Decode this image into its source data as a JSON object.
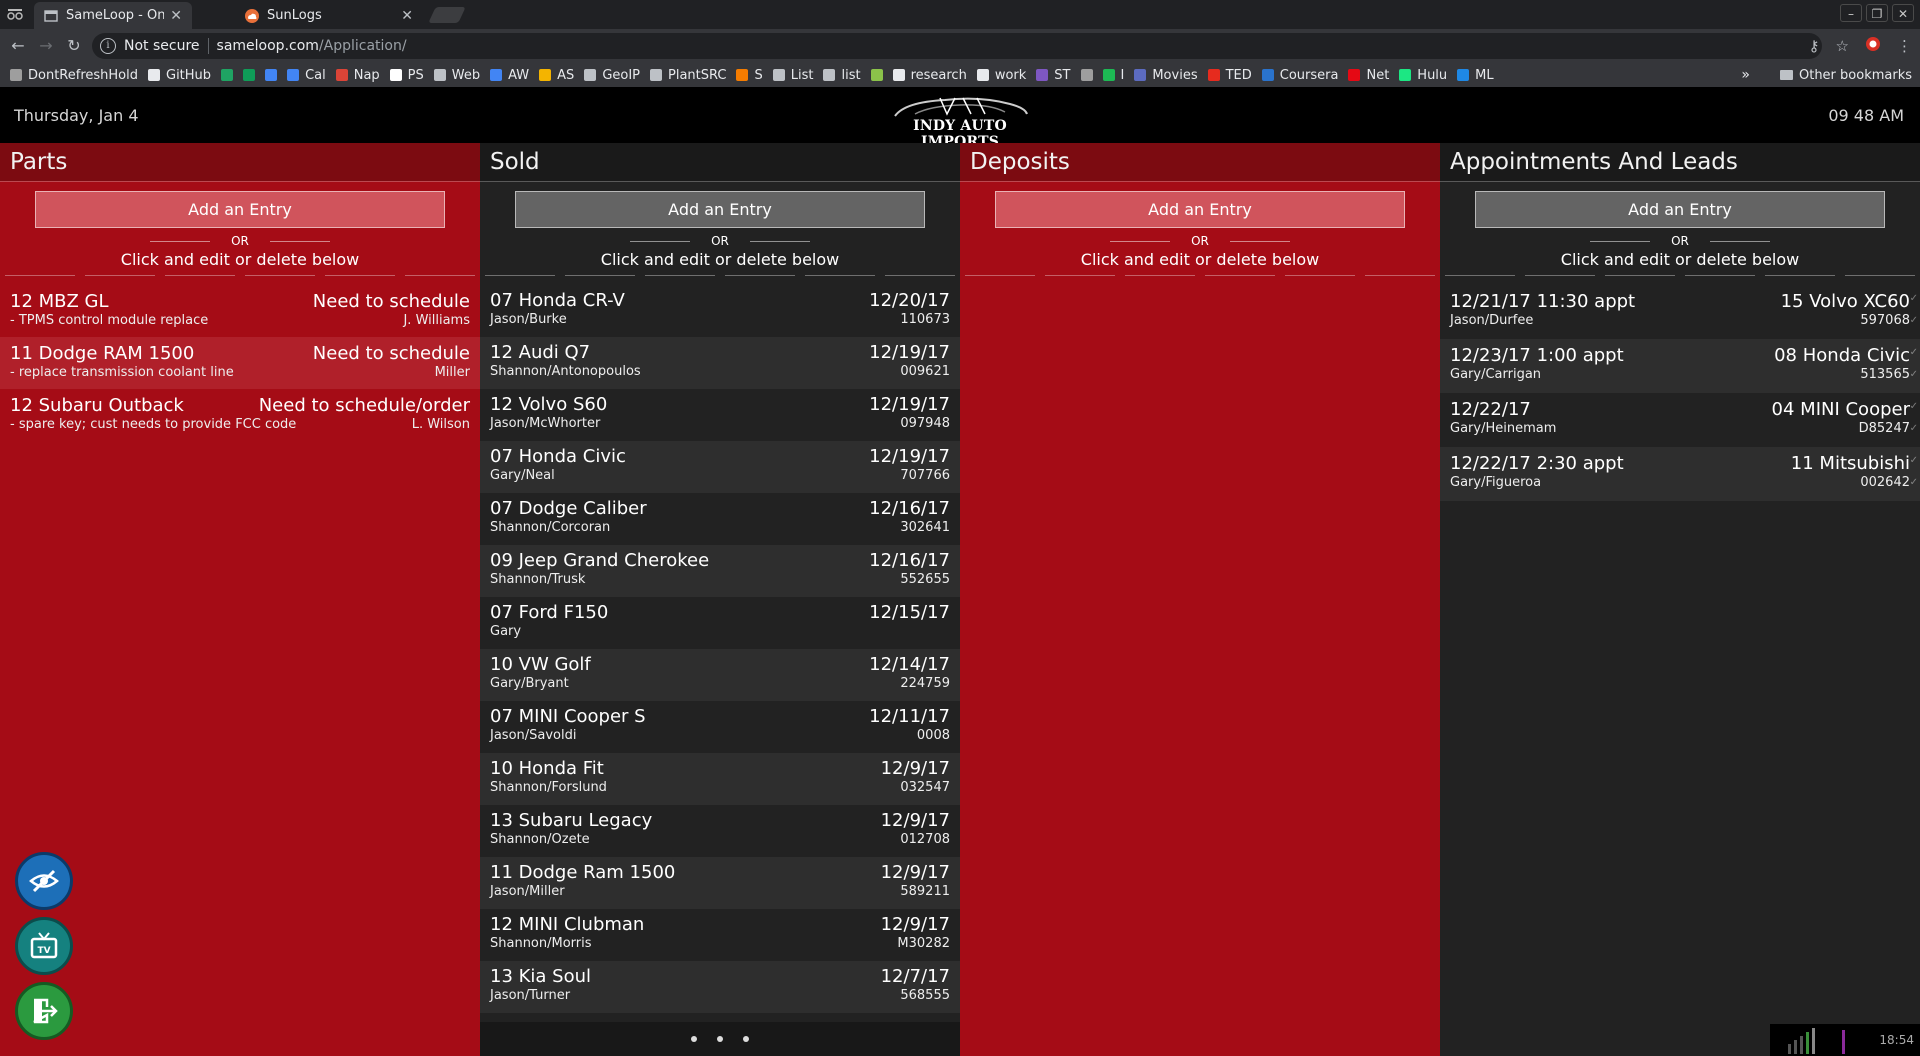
{
  "browser": {
    "tabs": [
      {
        "label": "SameLoop - On the",
        "active": true,
        "icon": "page-icon"
      },
      {
        "label": "SunLogs",
        "active": false,
        "icon": "cloud-icon"
      }
    ],
    "security_label": "Not secure",
    "url_host": "sameloop.com",
    "url_path": "/Application/",
    "bookmarks": [
      {
        "label": "DontRefreshHold",
        "color": "#9e9e9e"
      },
      {
        "label": "GitHub",
        "color": "#e8eaed"
      },
      {
        "label": "",
        "color": "#1fa463"
      },
      {
        "label": "",
        "color": "#0f9d58"
      },
      {
        "label": "",
        "color": "#4285f4"
      },
      {
        "label": "Cal",
        "color": "#4285f4"
      },
      {
        "label": "Nap",
        "color": "#db4437"
      },
      {
        "label": "PS",
        "color": "#ffffff"
      },
      {
        "label": "Web",
        "color": "#bdc1c6"
      },
      {
        "label": "AW",
        "color": "#4285f4"
      },
      {
        "label": "AS",
        "color": "#f4b400"
      },
      {
        "label": "GeoIP",
        "color": "#bdc1c6"
      },
      {
        "label": "PlantSRC",
        "color": "#bdc1c6"
      },
      {
        "label": "S",
        "color": "#f57c00"
      },
      {
        "label": "List",
        "color": "#bdc1c6"
      },
      {
        "label": "list",
        "color": "#bdc1c6"
      },
      {
        "label": "",
        "color": "#8bc34a"
      },
      {
        "label": "research",
        "color": "#e8eaed"
      },
      {
        "label": "work",
        "color": "#e8eaed"
      },
      {
        "label": "ST",
        "color": "#7e57c2"
      },
      {
        "label": "",
        "color": "#9e9e9e"
      },
      {
        "label": "I",
        "color": "#1db954"
      },
      {
        "label": "Movies",
        "color": "#5c6bc0"
      },
      {
        "label": "TED",
        "color": "#e62b1e"
      },
      {
        "label": "Coursera",
        "color": "#2a73cc"
      },
      {
        "label": "Net",
        "color": "#e50914"
      },
      {
        "label": "Hulu",
        "color": "#1ce783"
      },
      {
        "label": "ML",
        "color": "#1e88e5"
      }
    ],
    "bookmarks_overflow": "»",
    "other_bookmarks": "Other bookmarks"
  },
  "header": {
    "date": "Thursday, Jan 4",
    "time": "09 48 AM",
    "logo_text": "INDY AUTO IMPORTS"
  },
  "common": {
    "add_label": "Add an Entry",
    "or_label": "OR",
    "instruction": "Click and edit or delete below"
  },
  "columns": {
    "parts": {
      "title": "Parts",
      "items": [
        {
          "title": "12 MBZ GL",
          "sub": "- TPMS control module replace",
          "right": "Need to schedule",
          "right_sub": "J. Williams"
        },
        {
          "title": "11 Dodge RAM 1500",
          "sub": "- replace transmission coolant line",
          "right": "Need to schedule",
          "right_sub": "Miller"
        },
        {
          "title": "12 Subaru Outback",
          "sub": "- spare key; cust needs to provide FCC code",
          "right": "Need to schedule/order",
          "right_sub": "L. Wilson"
        }
      ]
    },
    "sold": {
      "title": "Sold",
      "items": [
        {
          "title": "07 Honda CR-V",
          "sub": "Jason/Burke",
          "right": "12/20/17",
          "right_sub": "110673"
        },
        {
          "title": "12 Audi Q7",
          "sub": "Shannon/Antonopoulos",
          "right": "12/19/17",
          "right_sub": "009621"
        },
        {
          "title": "12 Volvo S60",
          "sub": "Jason/McWhorter",
          "right": "12/19/17",
          "right_sub": "097948"
        },
        {
          "title": "07 Honda Civic",
          "sub": "Gary/Neal",
          "right": "12/19/17",
          "right_sub": "707766"
        },
        {
          "title": "07 Dodge Caliber",
          "sub": "Shannon/Corcoran",
          "right": "12/16/17",
          "right_sub": "302641"
        },
        {
          "title": "09 Jeep Grand Cherokee",
          "sub": "Shannon/Trusk",
          "right": "12/16/17",
          "right_sub": "552655"
        },
        {
          "title": "07 Ford F150",
          "sub": "Gary",
          "right": "12/15/17",
          "right_sub": ""
        },
        {
          "title": "10 VW Golf",
          "sub": "Gary/Bryant",
          "right": "12/14/17",
          "right_sub": "224759"
        },
        {
          "title": "07 MINI Cooper S",
          "sub": "Jason/Savoldi",
          "right": "12/11/17",
          "right_sub": "0008"
        },
        {
          "title": "10 Honda Fit",
          "sub": "Shannon/Forslund",
          "right": "12/9/17",
          "right_sub": "032547"
        },
        {
          "title": "13 Subaru Legacy",
          "sub": "Shannon/Ozete",
          "right": "12/9/17",
          "right_sub": "012708"
        },
        {
          "title": "11 Dodge Ram 1500",
          "sub": "Jason/Miller",
          "right": "12/9/17",
          "right_sub": "589211"
        },
        {
          "title": "12 MINI Clubman",
          "sub": "Shannon/Morris",
          "right": "12/9/17",
          "right_sub": "M30282"
        },
        {
          "title": "13 Kia Soul",
          "sub": "Jason/Turner",
          "right": "12/7/17",
          "right_sub": "568555"
        }
      ],
      "pages": 3
    },
    "deposits": {
      "title": "Deposits",
      "items": []
    },
    "appts": {
      "title": "Appointments And Leads",
      "items": [
        {
          "title": "12/21/17 11:30 appt",
          "sub": "Jason/Durfee",
          "right": "15 Volvo XC60",
          "right_sub": "597068"
        },
        {
          "title": "12/23/17 1:00 appt",
          "sub": "Gary/Carrigan",
          "right": "08 Honda Civic",
          "right_sub": "513565"
        },
        {
          "title": "12/22/17",
          "sub": "Gary/Heinemam",
          "right": "04 MINI Cooper",
          "right_sub": "D85247"
        },
        {
          "title": "12/22/17 2:30 appt",
          "sub": "Gary/Figueroa",
          "right": "11 Mitsubishi",
          "right_sub": "002642"
        }
      ]
    }
  },
  "fabs": [
    {
      "name": "hide-icon",
      "color": "#1d6fb8"
    },
    {
      "name": "tv-icon",
      "color": "#15817f"
    },
    {
      "name": "exit-icon",
      "color": "#2b9a3f"
    }
  ],
  "tray": {
    "clock": "18:54"
  }
}
